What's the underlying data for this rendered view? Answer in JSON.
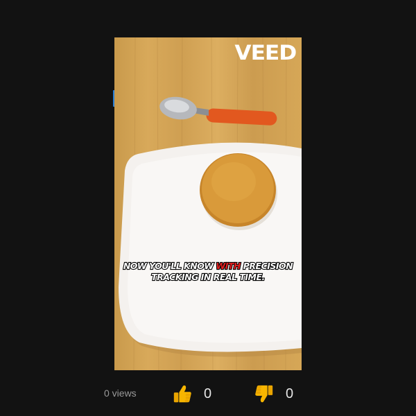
{
  "video": {
    "watermark": "VEED",
    "caption_pre": "NOW YOU'LL KNOW ",
    "caption_highlight": "WITH",
    "caption_post": " PRECISION TRACKING IN REAL TIME.",
    "caption_highlight_color": "#e52222"
  },
  "footer": {
    "views": "0 views",
    "likes": "0",
    "dislikes": "0",
    "like_icon": "thumbs-up-icon",
    "dislike_icon": "thumbs-down-icon"
  }
}
